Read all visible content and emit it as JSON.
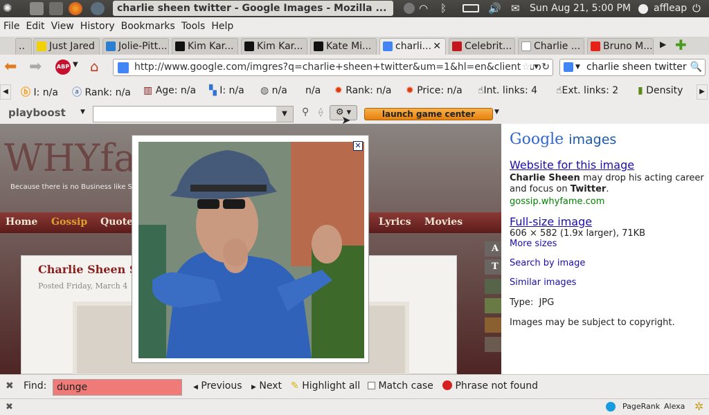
{
  "panel": {
    "window_title": "charlie sheen twitter - Google Images - Mozilla ...",
    "clock": "Sun Aug 21,  5:00 PM",
    "user": "affleap"
  },
  "menu": [
    "File",
    "Edit",
    "View",
    "History",
    "Bookmarks",
    "Tools",
    "Help"
  ],
  "tabs": [
    {
      "label": "..",
      "fav_color": "#d0cec9"
    },
    {
      "label": "Just Jared",
      "fav_color": "#f2d100"
    },
    {
      "label": "Jolie-Pitt...",
      "fav_color": "#2b7fd1"
    },
    {
      "label": "Kim Kar...",
      "fav_color": "#111111"
    },
    {
      "label": "Kim Kar...",
      "fav_color": "#111111"
    },
    {
      "label": "Kate Mi...",
      "fav_color": "#111111"
    },
    {
      "label": "charli...",
      "fav_color": "#4285f4",
      "active": true
    },
    {
      "label": "Celebrit...",
      "fav_color": "#c4161c"
    },
    {
      "label": "Charlie ...",
      "fav_color": "#ffffff"
    },
    {
      "label": "Bruno M...",
      "fav_color": "#e62117"
    }
  ],
  "nav": {
    "url": "http://www.google.com/imgres?q=charlie+sheen+twitter&um=1&hl=en&client=ub",
    "search": "charlie sheen twitter",
    "abp": "ABP"
  },
  "seo": {
    "items": [
      "I: n/a",
      "Rank: n/a",
      "Age: n/a",
      "I: n/a",
      "n/a",
      "n/a",
      "Rank: n/a",
      "Price: n/a",
      "Int. links: 4",
      "Ext. links: 2",
      "Density"
    ]
  },
  "playboost": {
    "brand": "playboost",
    "launch": "launch game center"
  },
  "site": {
    "logo": "WHYfa",
    "tagline": "Because there is no Business like Sh",
    "nav": [
      "Home",
      "Gossip",
      "Quotes",
      "Lyrics",
      "Movies"
    ],
    "article_title": "Charlie Sheen S",
    "article_posted": "Posted Friday, March 4",
    "side_letters": [
      "A",
      "T"
    ]
  },
  "lightbox": {
    "close": "✕"
  },
  "gpanel": {
    "brand_google": "Google",
    "brand_images": "images",
    "website_link": "Website for this image",
    "desc_bold1": "Charlie Sheen",
    "desc_mid": " may drop his acting career and focus on ",
    "desc_bold2": "Twitter",
    "desc_end": ".",
    "source": "gossip.whyfame.com",
    "fullsize_link": "Full-size image",
    "dims": "606 × 582 (1.9x larger), 71KB",
    "more_sizes": "More sizes",
    "search_by_image": "Search by image",
    "similar": "Similar images",
    "type_label": "Type:",
    "type_value": "JPG",
    "copyright": "Images may be subject to copyright."
  },
  "findbar": {
    "label": "Find:",
    "query": "dunge",
    "previous": "Previous",
    "next": "Next",
    "highlight": "Highlight all",
    "match_case": "Match case",
    "status": "Phrase not found"
  },
  "statusbar": {
    "pagerank": "PageRank",
    "alexa": "Alexa"
  }
}
